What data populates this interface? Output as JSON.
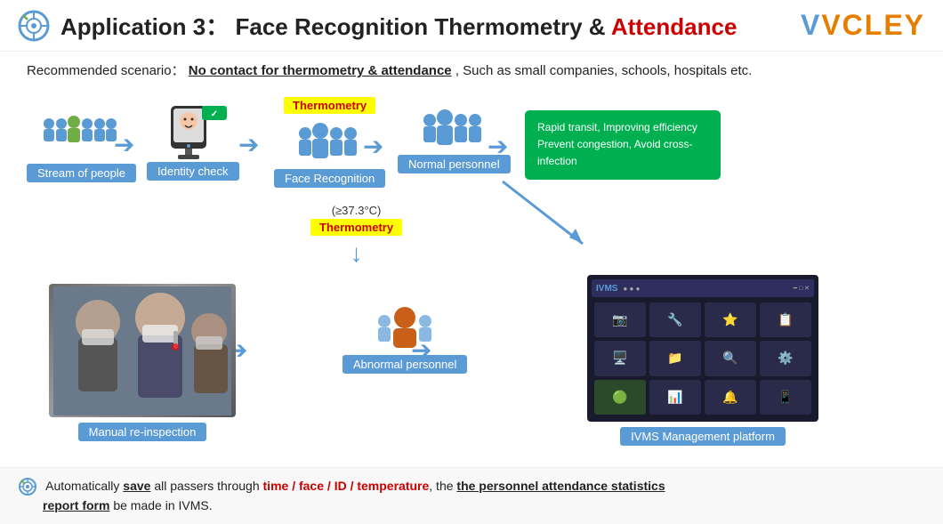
{
  "header": {
    "app_label": "Application 3：",
    "title": "Face Recognition Thermometry & ",
    "highlight": "Attendance",
    "logo": "VCLEY"
  },
  "scenario": {
    "label": "Recommended scenario：",
    "underline_text": "No contact for thermometry & attendance",
    "rest": ",  Such as small companies, schools, hospitals etc."
  },
  "flow": {
    "items": [
      {
        "label": "Stream of people"
      },
      {
        "label": "Identity check"
      },
      {
        "label": "Face Recognition"
      },
      {
        "label": "Normal personnel"
      }
    ],
    "thermometry_badge": "Thermometry",
    "thermometry_badge2": "Thermometry",
    "temp_label": "(≥37.3°C)",
    "abnormal_label": "Abnormal personnel",
    "manual_label": "Manual re-inspection",
    "ivms_label": "IVMS Management platform",
    "green_box_line1": "Rapid transit, Improving efficiency",
    "green_box_line2": "Prevent congestion, Avoid cross-infection"
  },
  "bottom": {
    "prefix": "Automatically ",
    "save_bold": "save",
    "middle": " all passers through ",
    "time": "time",
    "slash1": " / ",
    "face": "face",
    "slash2": " / ",
    "id": "ID",
    "slash3": " / ",
    "temperature": "temperature",
    "comma": ",  the ",
    "stats_bold": "the personnel attendance statistics",
    "report_bold": "report form",
    "suffix": " be made in IVMS."
  },
  "colors": {
    "accent_blue": "#5b9bd5",
    "accent_red": "#c00",
    "accent_green": "#00b050",
    "accent_yellow": "#ffff00",
    "accent_orange": "#e67e00"
  }
}
